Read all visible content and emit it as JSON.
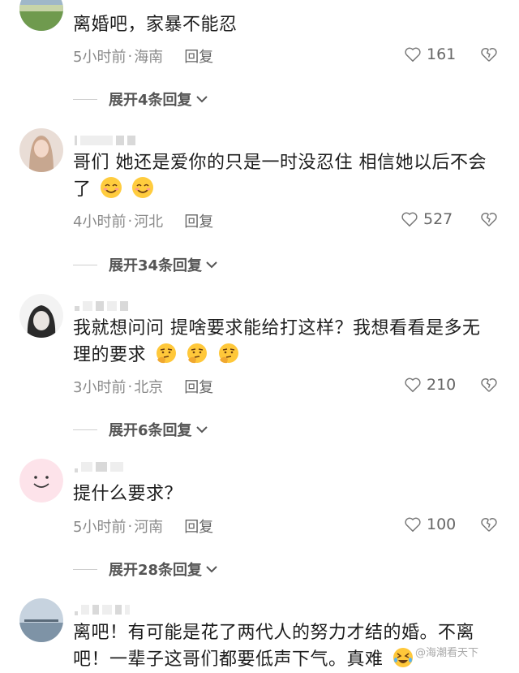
{
  "comments": [
    {
      "text": "离婚吧，家暴不能忍",
      "time": "5小时前",
      "location": "海南",
      "reply": "回复",
      "likes": "161",
      "expand": "展开4条回复"
    },
    {
      "text": "哥们 她还是爱你的只是一时没忍住 相信她以后不会了",
      "time": "4小时前",
      "location": "河北",
      "reply": "回复",
      "likes": "527",
      "expand": "展开34条回复"
    },
    {
      "text": "我就想问问 提啥要求能给打这样？我想看看是多无理的要求",
      "time": "3小时前",
      "location": "北京",
      "reply": "回复",
      "likes": "210",
      "expand": "展开6条回复"
    },
    {
      "text": "提什么要求？",
      "time": "5小时前",
      "location": "河南",
      "reply": "回复",
      "likes": "100",
      "expand": "展开28条回复"
    },
    {
      "text": "离吧！有可能是花了两代人的努力才结的婚。不离吧！一辈子这哥们都要低声下气。真难"
    }
  ],
  "dot": "·",
  "watermark": "@海潮看天下",
  "icons": {
    "like": "heart-outline-icon",
    "dislike": "broken-heart-icon",
    "chevron": "chevron-down-icon"
  }
}
